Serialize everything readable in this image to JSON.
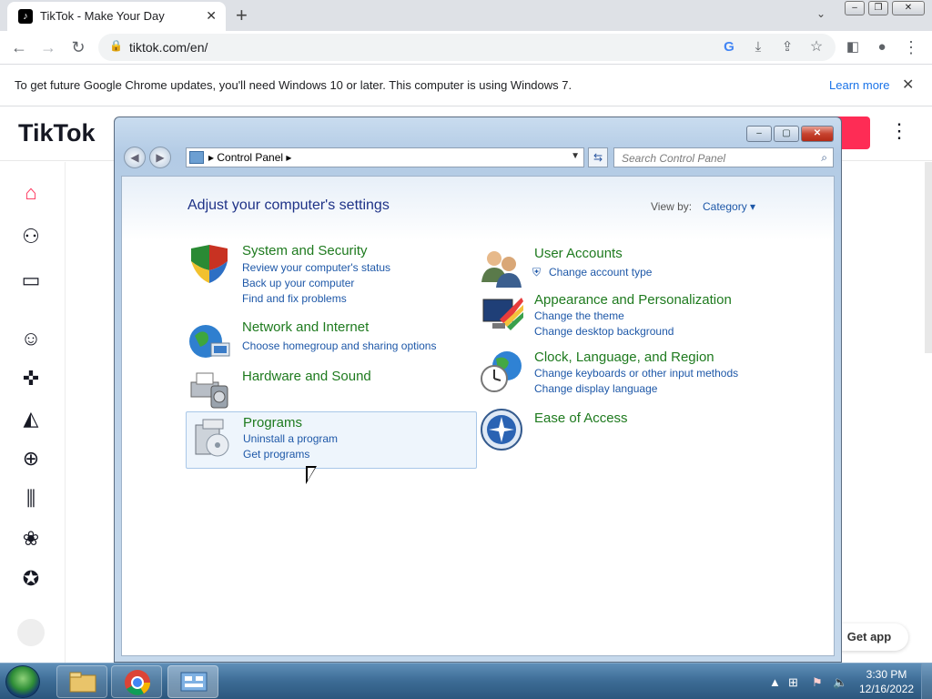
{
  "browser": {
    "tab_title": "TikTok - Make Your Day",
    "new_tab_glyph": "+",
    "url": "tiktok.com/en/",
    "infobar_message": "To get future Google Chrome updates, you'll need Windows 10 or later. This computer is using Windows 7.",
    "infobar_link": "Learn more"
  },
  "tiktok": {
    "logo_text": "TikTok",
    "get_app": "Get app",
    "accent": "#fe2c55"
  },
  "control_panel": {
    "breadcrumb": "Control Panel",
    "search_placeholder": "Search Control Panel",
    "heading": "Adjust your computer's settings",
    "view_by_label": "View by:",
    "view_by_value": "Category ▾",
    "categories": [
      {
        "title": "System and Security",
        "links": [
          "Review your computer's status",
          "Back up your computer",
          "Find and fix problems"
        ]
      },
      {
        "title": "Network and Internet",
        "links": [
          "Choose homegroup and sharing options"
        ]
      },
      {
        "title": "Hardware and Sound",
        "links": []
      },
      {
        "title": "Programs",
        "links": [
          "Uninstall a program",
          "Get programs"
        ]
      },
      {
        "title": "User Accounts",
        "links": [
          "Change account type"
        ]
      },
      {
        "title": "Appearance and Personalization",
        "links": [
          "Change the theme",
          "Change desktop background"
        ]
      },
      {
        "title": "Clock, Language, and Region",
        "links": [
          "Change keyboards or other input methods",
          "Change display language"
        ]
      },
      {
        "title": "Ease of Access",
        "links": []
      }
    ],
    "title_color": "#1e7a1e",
    "link_color": "#1e58a8"
  },
  "taskbar": {
    "time": "3:30 PM",
    "date": "12/16/2022"
  }
}
